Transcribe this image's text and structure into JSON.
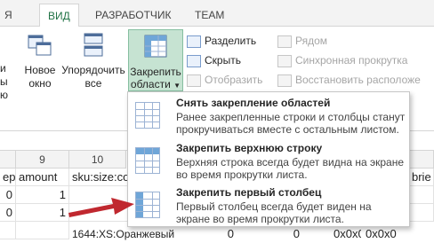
{
  "tabs": [
    {
      "label": "Я"
    },
    {
      "label": "ВИД"
    },
    {
      "label": "РАЗРАБОТЧИК"
    },
    {
      "label": "TEAM"
    }
  ],
  "ribbon": {
    "left_cut": [
      "и",
      "ы",
      "ю"
    ],
    "new_window": "Новое\nокно",
    "new_window_l1": "Новое",
    "new_window_l2": "окно",
    "arrange_all_l1": "Упорядочить",
    "arrange_all_l2": "все",
    "freeze_l1": "Закрепить",
    "freeze_l2": "области",
    "split": "Разделить",
    "hide": "Скрыть",
    "unhide": "Отобразить",
    "side_by_side": "Рядом",
    "sync_scroll": "Синхронная прокрутка",
    "reset_position": "Восстановить расположе"
  },
  "grid": {
    "col_headers": [
      "9",
      "10"
    ],
    "row1": {
      "c0": "ер",
      "c1": "amount",
      "c2": "sku:size:co",
      "c_right": "brie"
    },
    "row2": {
      "c0": "0",
      "c1": "1"
    },
    "row3": {
      "c0": "0",
      "c1": "1"
    },
    "row4": {
      "c2": "1644:XS:Оранжевый",
      "v1": "0",
      "v2": "0",
      "v3": "0x0x0"
    }
  },
  "menu": {
    "items": [
      {
        "title": "Снять закрепление областей",
        "desc": "Ранее закрепленные строки и столбцы станут прокручиваться вместе с остальным листом."
      },
      {
        "title": "Закрепить верхнюю строку",
        "desc": "Верхняя строка всегда будет видна на экране во время прокрутки листа."
      },
      {
        "title": "Закрепить первый столбец",
        "desc": "Первый столбец всегда будет виден на экране во время прокрутки листа."
      }
    ]
  },
  "colors": {
    "accent": "#217346",
    "selected_bg": "#c6e3d2",
    "arrow": "#c0282f"
  }
}
